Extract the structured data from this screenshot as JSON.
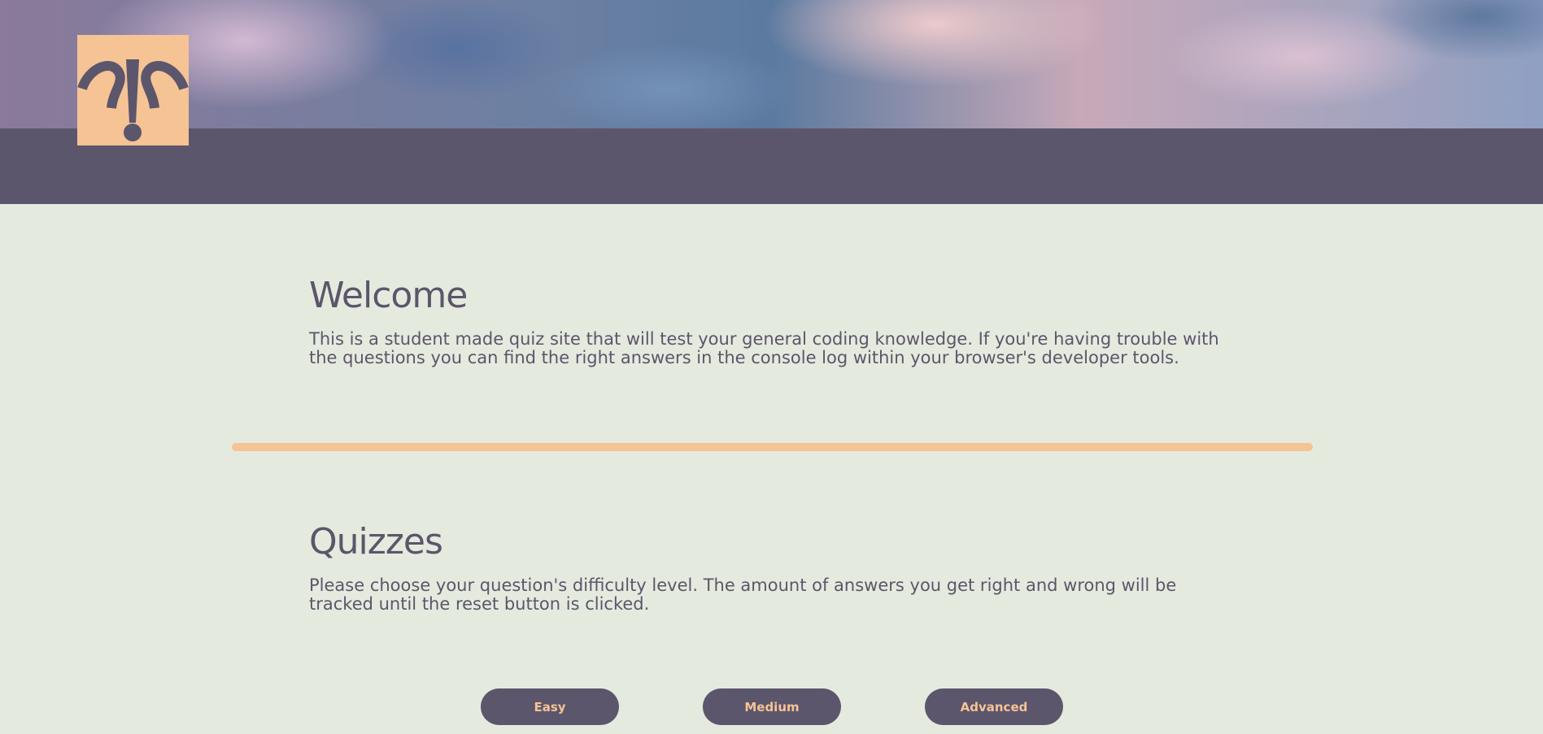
{
  "header": {
    "logo_icon": "question-exclamation-logo-icon",
    "colors": {
      "band": "#5c566c",
      "logo_bg": "#f6c395"
    }
  },
  "welcome": {
    "title": "Welcome",
    "text": "This is a student made quiz site that will test your general coding knowledge. If you're having trouble with the questions you can find the right answers in the console log within your browser's developer tools."
  },
  "quizzes": {
    "title": "Quizzes",
    "text": "Please choose your question's difficulty level. The amount of answers you get right and wrong will be tracked until the reset button is clicked."
  },
  "buttons": {
    "easy": "Easy",
    "medium": "Medium",
    "advanced": "Advanced"
  },
  "colors": {
    "background": "#e5eadf",
    "text": "#5b566a",
    "accent": "#f6c395"
  }
}
